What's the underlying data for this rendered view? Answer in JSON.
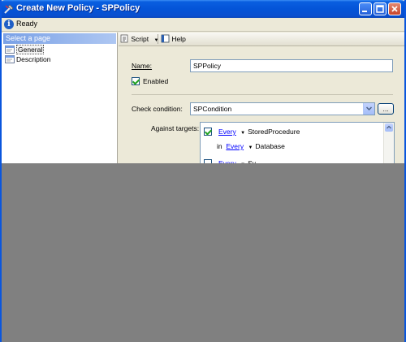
{
  "window": {
    "title": "Create New Policy - SPPolicy"
  },
  "status": {
    "text": "Ready"
  },
  "left_pane": {
    "header": "Select a page",
    "pages": [
      {
        "label": "General"
      },
      {
        "label": "Description"
      }
    ]
  },
  "toolbar": {
    "script_label": "Script",
    "help_label": "Help"
  },
  "form": {
    "name_label": "Name:",
    "name_value": "SPPolicy",
    "enabled_label": "Enabled",
    "check_condition_label": "Check condition:",
    "check_condition_value": "SPCondition",
    "ellipsis": "...",
    "against_targets_label": "Against targets:",
    "targets": [
      {
        "qualifier": "Every",
        "type": "StoredProcedure"
      },
      {
        "in_label": "in",
        "qualifier": "Every",
        "type": "Database"
      },
      {
        "qualifier": "Every",
        "type": "Sy..."
      }
    ]
  },
  "colors": {
    "title_blue": "#0454d8",
    "link_blue": "#0000ff",
    "check_green": "#21a121",
    "overlay_gray": "#808080"
  }
}
